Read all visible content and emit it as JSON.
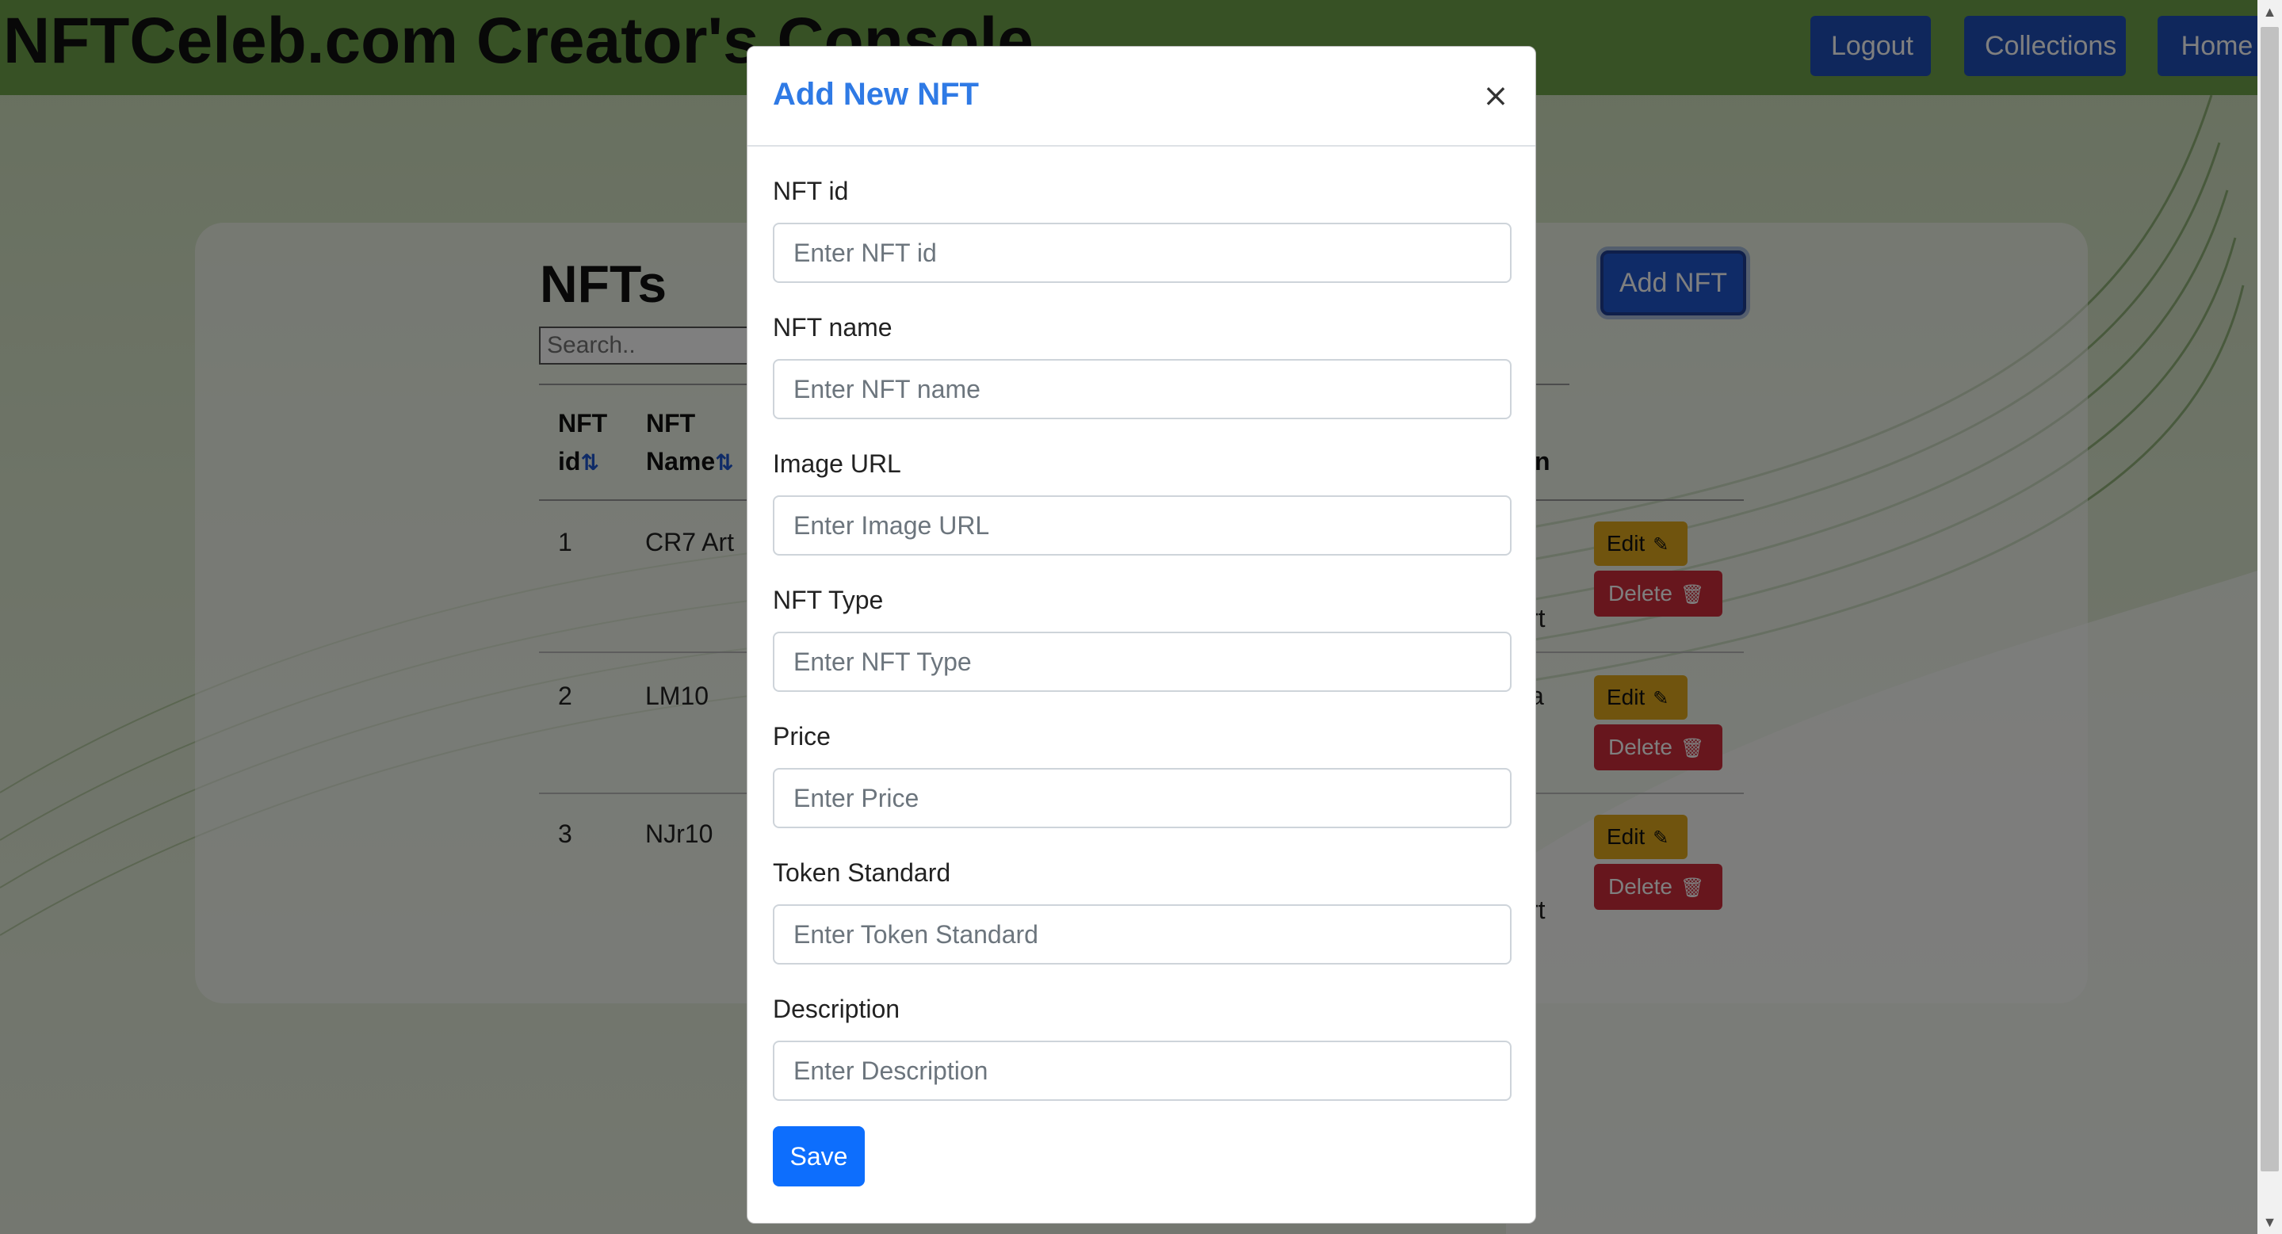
{
  "navbar": {
    "brand": "NFTCeleb.com Creator's Console",
    "buttons": [
      "Logout",
      "Collections",
      "Home"
    ]
  },
  "main": {
    "title": "NFTs",
    "search_placeholder": "Search..",
    "add_button": "Add NFT",
    "columns": [
      {
        "line1": "NFT",
        "line2": "id",
        "sort_icon": "⇅"
      },
      {
        "line1": "NFT",
        "line2": "Name",
        "sort_icon": "⇅"
      }
    ],
    "hidden_column_fragment": "n",
    "rows": [
      {
        "id": "1",
        "name": "CR7 Art",
        "peek": "rt"
      },
      {
        "id": "2",
        "name": "LM10",
        "peek": "a"
      },
      {
        "id": "3",
        "name": "NJr10",
        "peek": "rt"
      }
    ],
    "edit_label": "Edit",
    "edit_icon": "✎",
    "delete_label": "Delete",
    "delete_icon": "🗑"
  },
  "modal": {
    "title": "Add New NFT",
    "close_symbol": "×",
    "fields": [
      {
        "label": "NFT id",
        "placeholder": "Enter NFT id"
      },
      {
        "label": "NFT name",
        "placeholder": "Enter NFT name"
      },
      {
        "label": "Image URL",
        "placeholder": "Enter Image URL"
      },
      {
        "label": "NFT Type",
        "placeholder": "Enter NFT Type"
      },
      {
        "label": "Price",
        "placeholder": "Enter Price"
      },
      {
        "label": "Token Standard",
        "placeholder": "Enter Token Standard"
      },
      {
        "label": "Description",
        "placeholder": "Enter Description"
      }
    ],
    "save_label": "Save"
  },
  "colors": {
    "navbar": "#6ea24a",
    "modal_title": "#2f7ae5",
    "primary": "#0d6efd",
    "edit": "#e0a91c",
    "delete": "#cf2d3b"
  }
}
